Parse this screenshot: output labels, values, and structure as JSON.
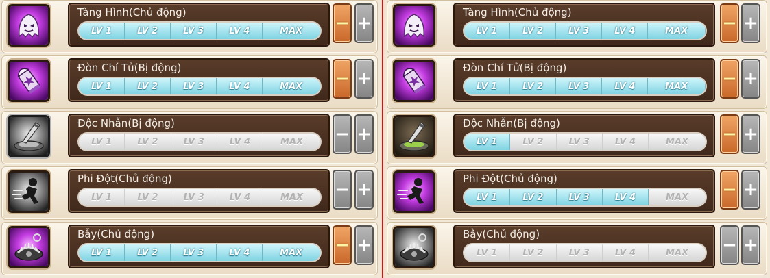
{
  "level_labels": [
    "LV 1",
    "LV 2",
    "LV 3",
    "LV 4",
    "MAX"
  ],
  "buttons": {
    "minus": "−",
    "plus": "+"
  },
  "colors": {
    "level_active": "#8fdbe8",
    "level_inactive": "#e4e4e4",
    "button_active": "#d9783a",
    "button_inactive": "#9a9a9a",
    "divider": "#c8191a"
  },
  "left_panel": {
    "skills": [
      {
        "name": "Tàng Hình(Chủ động)",
        "icon": "ghost-icon",
        "level": 5,
        "minus_active": true
      },
      {
        "name": "Đòn Chí Tử(Bị động)",
        "icon": "bullet-star-icon",
        "level": 5,
        "minus_active": true
      },
      {
        "name": "Độc Nhẫn(Bị động)",
        "icon": "poison-knife-icon",
        "level": 0,
        "minus_active": false
      },
      {
        "name": "Phi Đột(Chủ động)",
        "icon": "dash-runner-icon",
        "level": 0,
        "minus_active": false
      },
      {
        "name": "Bẫy(Chủ động)",
        "icon": "trap-icon",
        "level": 5,
        "minus_active": true
      }
    ]
  },
  "right_panel": {
    "skills": [
      {
        "name": "Tàng Hình(Chủ động)",
        "icon": "ghost-icon",
        "level": 5,
        "minus_active": true
      },
      {
        "name": "Đòn Chí Tử(Bị động)",
        "icon": "bullet-star-icon",
        "level": 5,
        "minus_active": true
      },
      {
        "name": "Độc Nhẫn(Bị động)",
        "icon": "poison-knife-icon",
        "level": 1,
        "minus_active": true
      },
      {
        "name": "Phi Đột(Chủ động)",
        "icon": "dash-runner-icon",
        "level": 4,
        "minus_active": true
      },
      {
        "name": "Bẫy(Chủ động)",
        "icon": "trap-icon",
        "level": 0,
        "minus_active": false
      }
    ]
  }
}
